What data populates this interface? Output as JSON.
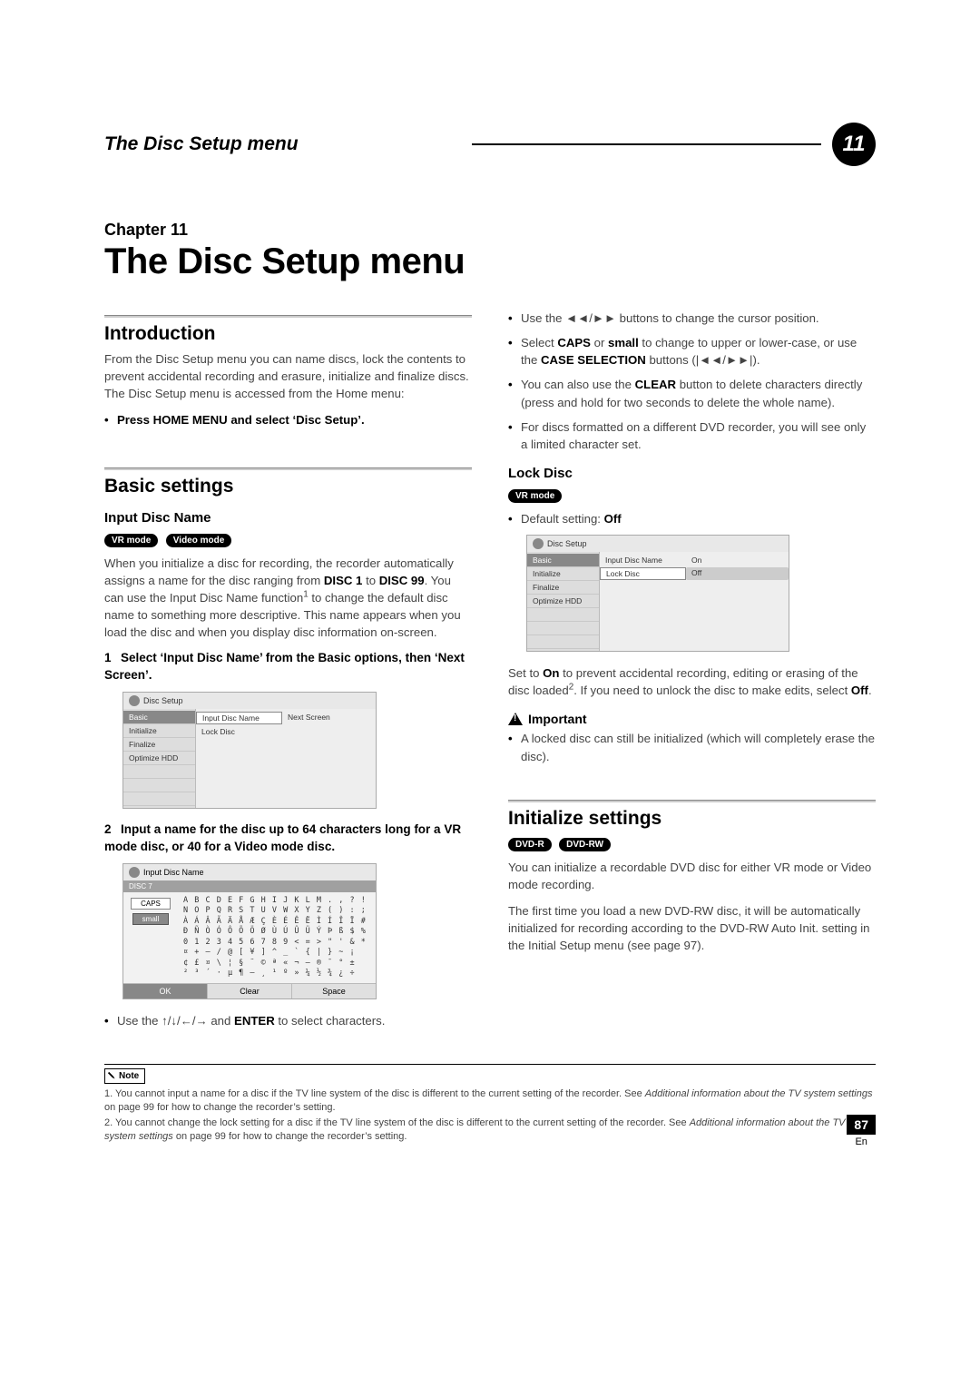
{
  "header": {
    "section_title": "The Disc Setup menu",
    "chapter_number": "11"
  },
  "chapter": {
    "label": "Chapter 11",
    "title": "The Disc Setup menu"
  },
  "intro": {
    "title": "Introduction",
    "body": "From the Disc Setup menu you can name discs, lock the contents to prevent accidental recording and erasure, initialize and finalize discs. The Disc Setup menu is accessed from the Home menu:",
    "bullet_bold": "Press HOME MENU and select ‘Disc Setup’."
  },
  "basic": {
    "title": "Basic settings",
    "input_name": {
      "title": "Input Disc Name",
      "pills": [
        "VR mode",
        "Video mode"
      ],
      "para_a_pre": "When you initialize a disc for recording, the recorder automatically assigns a name for the disc ranging from ",
      "disc1": "DISC 1",
      "to": " to ",
      "disc99": "DISC 99",
      "para_a_post1": ". You can use the Input Disc Name function",
      "sup1": "1",
      "para_a_post2": " to change the default disc name to something more descriptive. This name appears when you load the disc and when you display disc information on-screen.",
      "step1_num": "1",
      "step1": "Select ‘Input Disc Name’ from the Basic options, then ‘Next Screen’.",
      "step2_num": "2",
      "step2": "Input a name for the disc up to 64 characters long for a VR mode disc, or 40 for a Video mode disc.",
      "use_arrows_pre": "Use the ",
      "arrows": "↑/↓/←/→",
      "use_arrows_mid": " and ",
      "enter": "ENTER",
      "use_arrows_post": " to select characters."
    },
    "lock": {
      "title": "Lock Disc",
      "pills": [
        "VR mode"
      ],
      "default_pre": "Default setting: ",
      "default_val": "Off",
      "set_on_pre": "Set to ",
      "on": "On",
      "set_on_mid": " to prevent accidental recording, editing or erasing of the disc loaded",
      "sup2": "2",
      "set_on_post1": ". If you need to unlock the disc to make edits, select ",
      "off": "Off",
      "period": ".",
      "important": "Important",
      "imp_bullet": "A locked disc can still be initialized (which will completely erase the disc)."
    }
  },
  "right_bullets": {
    "b1_pre": "Use the ",
    "b1_sym": "◄◄/►►",
    "b1_post": " buttons to change the cursor position.",
    "b2_pre": "Select ",
    "b2_caps": "CAPS",
    "b2_or": " or ",
    "b2_small": "small",
    "b2_mid": " to change to upper or lower-case, or use the ",
    "b2_case": "CASE SELECTION",
    "b2_btns": " buttons (|◄◄/►►|).",
    "b3_pre": "You can also use the ",
    "b3_clear": "CLEAR",
    "b3_post": " button to delete characters directly (press and hold for two seconds to delete the whole name).",
    "b4": "For discs formatted on a different DVD recorder, you will see only a limited character set."
  },
  "init": {
    "title": "Initialize settings",
    "pills": [
      "DVD-R",
      "DVD-RW"
    ],
    "p1": "You can initialize a recordable DVD disc for either VR mode or Video mode recording.",
    "p2": "The first time you load a new DVD-RW disc, it will be automatically initialized for recording according to the DVD-RW Auto Init. setting in the Initial Setup menu (see page 97)."
  },
  "ss1": {
    "title": "Disc Setup",
    "left": [
      "Basic",
      "Initialize",
      "Finalize",
      "Optimize HDD"
    ],
    "r1c1": "Input Disc Name",
    "r1c2": "Next Screen",
    "r2c1": "Lock Disc"
  },
  "ss2": {
    "title": "Input Disc Name",
    "name": "DISC 7",
    "caps": "CAPS",
    "small": "small",
    "row1": "A B C D E F G H I J K L M . , ? !",
    "row2": "N O P Q R S T U V W X Y Z ( ) : ;",
    "row3": "À Á Â Ã Ä Å Æ Ç È É Ê Ë Ì Í Î Ï #",
    "row4": "Ð Ñ Ò Ó Ô Õ Ö Ø Ù Ú Û Ü Ý Þ ß $ %",
    "row5": "0 1 2 3 4 5 6 7 8 9 < = > \" ' & *",
    "row6": "¤ + – / @ [ ¥ ] ^ _ ` { | } ~ ¡",
    "row7": "¢ £ ¤ \\ ¦ § ¨ © ª « ¬ – ® ¯ ° ±",
    "row8": "² ³ ´ · µ ¶ – ¸ ¹ º » ¼ ½ ¾ ¿ ÷",
    "ok": "OK",
    "clear": "Clear",
    "space": "Space"
  },
  "ss3": {
    "title": "Disc Setup",
    "left": [
      "Basic",
      "Initialize",
      "Finalize",
      "Optimize HDD"
    ],
    "r1c1": "Input Disc Name",
    "r1c2": "On",
    "r2c1": "Lock Disc",
    "r2c2": "Off"
  },
  "notes": {
    "label": "Note",
    "n1_pre": "1. You cannot input a name for a disc if the TV line system of the disc is different to the current setting of the recorder. See ",
    "n1_i": "Additional information about the TV system settings",
    "n1_post": " on page 99 for how to change the recorder’s setting.",
    "n2_pre": "2. You cannot change the lock setting for a disc if the TV line system of the disc is different to the current setting of the recorder. See ",
    "n2_i": "Additional information about the TV system settings",
    "n2_post": " on page 99 for how to change the recorder’s setting."
  },
  "footer": {
    "page": "87",
    "lang": "En"
  }
}
